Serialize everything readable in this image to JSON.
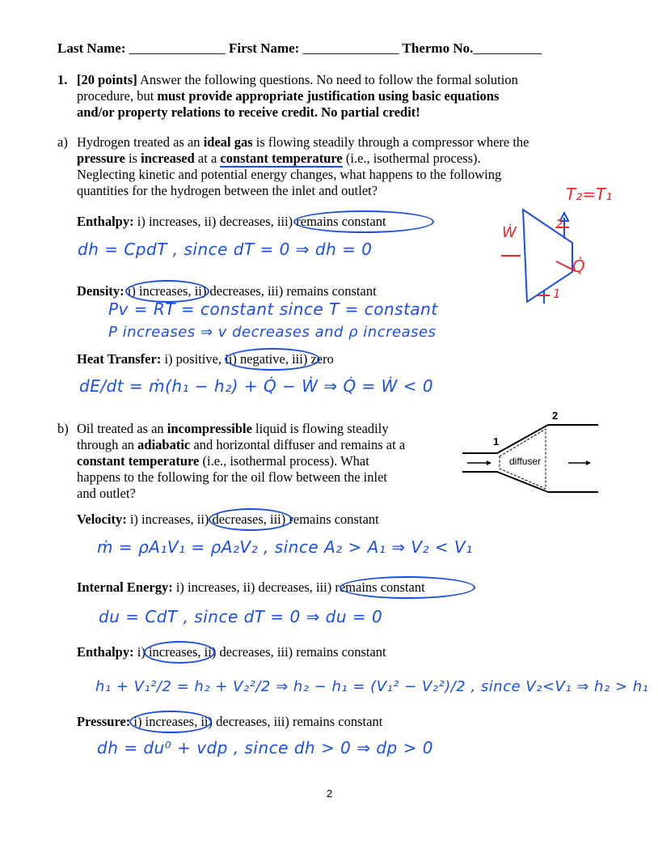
{
  "header": {
    "last_name_label": "Last Name:",
    "last_name_blank": "______________",
    "first_name_label": "First Name:",
    "first_name_blank": "______________",
    "thermo_label": "Thermo No.",
    "thermo_blank": "__________"
  },
  "question": {
    "number": "1.",
    "points": "[20 points]",
    "intro_plain_1": "Answer the following questions.  No need to follow the formal solution procedure, but",
    "intro_bold": "must provide appropriate justification using basic equations and/or property relations to receive credit.  No partial credit!",
    "line1": "Answer the following questions.  No need to follow the formal solution",
    "line2_plain": "procedure, but ",
    "line2_bold": "must provide appropriate justification using basic equations",
    "line3_bold": "and/or property relations to receive credit.  No partial credit!"
  },
  "part_a": {
    "label": "a)",
    "l1_a": "Hydrogen treated as an ",
    "l1_b": "ideal gas",
    "l1_c": " is flowing steadily through a compressor where the",
    "l2_a": "pressure",
    "l2_b": " is ",
    "l2_c": "increased",
    "l2_d": " at a ",
    "l2_e": "constant temperature",
    "l2_f": " (i.e., isothermal process).",
    "l3": "Neglecting kinetic and potential energy changes, what happens to the following",
    "l4": "quantities for the hydrogen between the inlet and outlet?",
    "questions": [
      {
        "label": "Enthalpy:",
        "options": " i) increases, ii) decreases, iii) remains constant",
        "selected": "iii) remains constant",
        "answer_lines": [
          "dh = CpdT ,  since dT = 0  ⇒  dh = 0"
        ]
      },
      {
        "label": "Density:",
        "options": " i) increases, ii) decreases, iii) remains constant",
        "selected": "i) increases",
        "answer_lines": [
          "Pv = RT = constant  since  T = constant",
          "P increases ⇒ v decreases  and  ρ increases"
        ]
      },
      {
        "label": "Heat Transfer:",
        "options": " i) positive, ii) negative, iii) zero",
        "selected": "ii) negative",
        "answer_lines": [
          "dE/dt = ṁ(h₁ − h₂) + Q̇ − Ẇ  ⇒  Q̇ = Ẇ < 0"
        ]
      }
    ],
    "sketch": {
      "note": "T₂=T₁",
      "work_label": "Ẇ",
      "heat_label": "Q̇",
      "inlet_label": "1",
      "outlet_label": "2"
    }
  },
  "part_b": {
    "label": "b)",
    "l1_a": "Oil treated as an ",
    "l1_b": "incompressible",
    "l1_c": " liquid is flowing steadily",
    "l2_a": "through an ",
    "l2_b": "adiabatic",
    "l2_c": " and horizontal diffuser and remains at a",
    "l3_a": "constant temperature",
    "l3_b": " (i.e., isothermal process).  What",
    "l4": "happens to the following for the oil flow between the inlet",
    "l5": "and outlet?",
    "diagram": {
      "inlet": "1",
      "outlet": "2",
      "label": "diffuser"
    },
    "questions": [
      {
        "label": "Velocity:",
        "options": " i) increases, ii) decreases, iii) remains constant",
        "selected": "ii) decreases",
        "answer_lines": [
          "ṁ = ρA₁V₁ = ρA₂V₂ ,  since  A₂ > A₁  ⇒  V₂ < V₁"
        ]
      },
      {
        "label": "Internal Energy:",
        "options": " i) increases, ii) decreases, iii) remains constant",
        "selected": "iii) remains constant",
        "answer_lines": [
          "du = CdT ,  since  dT = 0  ⇒  du = 0"
        ]
      },
      {
        "label": "Enthalpy:",
        "options": " i) increases, ii) decreases, iii) remains constant",
        "selected": "i) increases",
        "answer_lines": [
          "h₁ + V₁²/2 = h₂ + V₂²/2  ⇒  h₂ − h₁ = (V₁² − V₂²)/2 ,  since V₂<V₁ ⇒ h₂ > h₁"
        ]
      },
      {
        "label": "Pressure:",
        "options": " i) increases, ii) decreases, iii) remains constant",
        "selected": "i) increases",
        "answer_lines": [
          "dh = du⁰ + vdp ,  since  dh > 0  ⇒  dp > 0"
        ]
      }
    ]
  },
  "footer": {
    "page_number": "2"
  },
  "colors": {
    "ink_blue": "#1a4fe0",
    "ink_red": "#e8282a",
    "text": "#000000"
  }
}
